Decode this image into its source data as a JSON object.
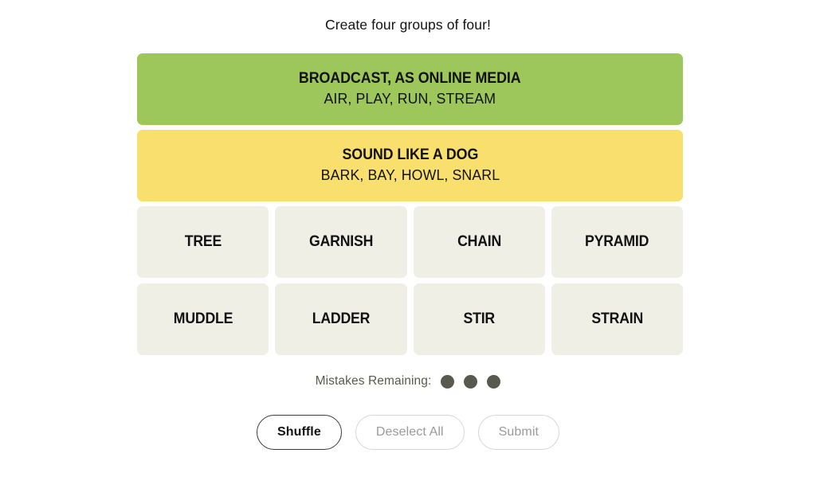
{
  "game": {
    "headline": "Create four groups of four!",
    "colors": {
      "green": "#9dc65b",
      "yellow": "#f9df6d",
      "tile": "#efefe6",
      "text": "#121212",
      "muted": "#5a594e",
      "disabled_text": "#9a9a9a",
      "disabled_border": "#d6d6d6",
      "active_border": "#3a3a3a",
      "page_background": "#ffffff"
    }
  },
  "solved_groups": [
    {
      "title": "BROADCAST, AS ONLINE MEDIA",
      "members": "AIR, PLAY, RUN, STREAM",
      "color": "#9dc65b",
      "difficulty": "green"
    },
    {
      "title": "SOUND LIKE A DOG",
      "members": "BARK, BAY, HOWL, SNARL",
      "color": "#f9df6d",
      "difficulty": "yellow"
    }
  ],
  "tile_rows": [
    [
      {
        "label": "TREE"
      },
      {
        "label": "GARNISH"
      },
      {
        "label": "CHAIN"
      },
      {
        "label": "PYRAMID"
      }
    ],
    [
      {
        "label": "MUDDLE"
      },
      {
        "label": "LADDER"
      },
      {
        "label": "STIR"
      },
      {
        "label": "STRAIN"
      }
    ]
  ],
  "mistakes": {
    "label": "Mistakes Remaining:",
    "remaining": 3,
    "dots": [
      1,
      2,
      3
    ]
  },
  "controls": {
    "shuffle": {
      "label": "Shuffle",
      "enabled": true
    },
    "deselect_all": {
      "label": "Deselect All",
      "enabled": false
    },
    "submit": {
      "label": "Submit",
      "enabled": false
    }
  }
}
